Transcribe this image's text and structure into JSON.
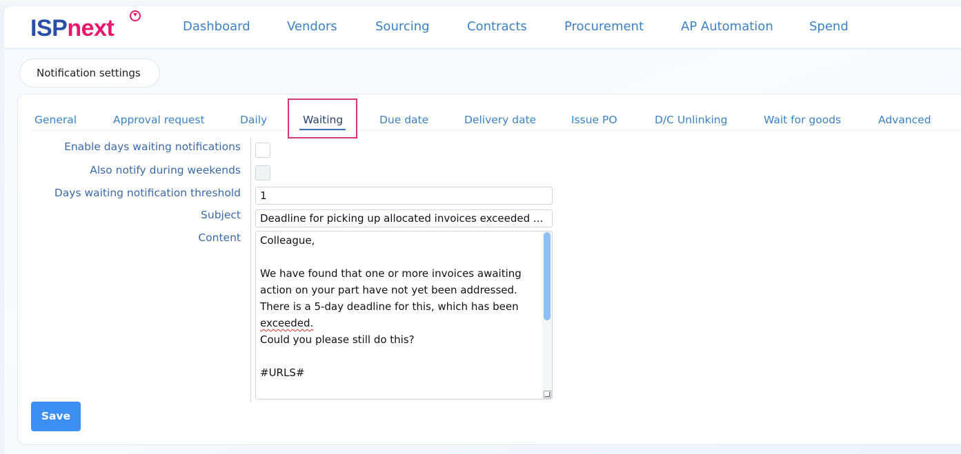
{
  "logo": {
    "part1": "ISP",
    "part2": "next"
  },
  "nav": {
    "items": [
      "Dashboard",
      "Vendors",
      "Sourcing",
      "Contracts",
      "Procurement",
      "AP Automation",
      "Spend"
    ]
  },
  "page": {
    "pill_label": "Notification settings"
  },
  "tabs": {
    "items": [
      "General",
      "Approval request",
      "Daily",
      "Waiting",
      "Due date",
      "Delivery date",
      "Issue PO",
      "D/C Unlinking",
      "Wait for goods",
      "Advanced"
    ],
    "active": "Waiting"
  },
  "form": {
    "enable_label": "Enable days waiting notifications",
    "weekends_label": "Also notify during weekends",
    "threshold_label": "Days waiting notification threshold",
    "threshold_value": "1",
    "subject_label": "Subject",
    "subject_value": "Deadline for picking up allocated invoices exceeded ...",
    "content_label": "Content",
    "content_lines": [
      "Colleague,",
      "",
      "We have found that one or more invoices awaiting",
      "action on your part have not yet been addressed.",
      "There is a 5-day deadline for this, which has been",
      "exceeded.",
      "Could you please still do this?",
      "",
      "#URLS#"
    ]
  },
  "actions": {
    "save_label": "Save"
  },
  "colors": {
    "brand_blue": "#2a4fa8",
    "brand_pink": "#e8196c",
    "link_blue": "#3b82c7",
    "save_button": "#3d8ef2",
    "highlight": "#d6337a"
  }
}
